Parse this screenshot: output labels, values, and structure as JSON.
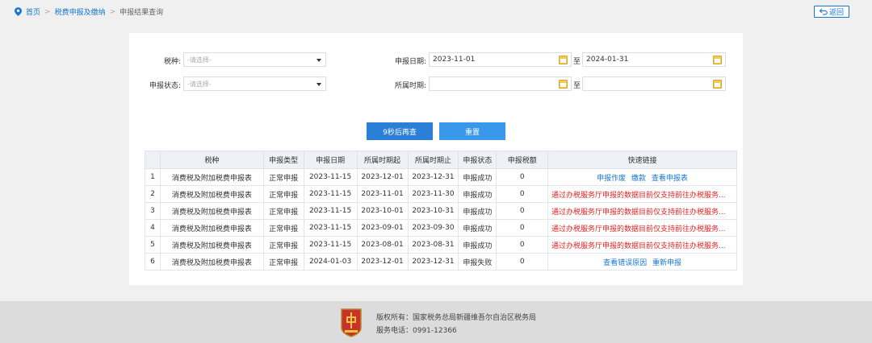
{
  "breadcrumb": {
    "home": "首页",
    "section": "税费申报及缴纳",
    "current": "申报结果查询",
    "sep": ">"
  },
  "back_label": "返回",
  "form": {
    "tax_type_label": "税种:",
    "tax_type_placeholder": "-请选择-",
    "status_label": "申报状态:",
    "status_placeholder": "-请选择-",
    "date_label": "申报日期:",
    "date_from": "2023-11-01",
    "date_to": "2024-01-31",
    "period_label": "所属时期:",
    "period_from": "",
    "period_to": "",
    "to": "至"
  },
  "buttons": {
    "query": "9秒后再查",
    "reset": "重置"
  },
  "table": {
    "headers": [
      "",
      "税种",
      "申报类型",
      "申报日期",
      "所属时期起",
      "所属时期止",
      "申报状态",
      "申报税额",
      "快速链接"
    ],
    "rows": [
      {
        "no": "1",
        "tax": "消费税及附加税费申报表",
        "type": "正常申报",
        "date": "2023-11-15",
        "from": "2023-12-01",
        "to": "2023-12-31",
        "status": "申报成功",
        "amount": "0",
        "links": [
          "申报作废",
          "缴款",
          "查看申报表"
        ],
        "msg": ""
      },
      {
        "no": "2",
        "tax": "消费税及附加税费申报表",
        "type": "正常申报",
        "date": "2023-11-15",
        "from": "2023-11-01",
        "to": "2023-11-30",
        "status": "申报成功",
        "amount": "0",
        "links": [],
        "msg": "通过办税服务厅申报的数据目前仅支持前往办税服务..."
      },
      {
        "no": "3",
        "tax": "消费税及附加税费申报表",
        "type": "正常申报",
        "date": "2023-11-15",
        "from": "2023-10-01",
        "to": "2023-10-31",
        "status": "申报成功",
        "amount": "0",
        "links": [],
        "msg": "通过办税服务厅申报的数据目前仅支持前往办税服务..."
      },
      {
        "no": "4",
        "tax": "消费税及附加税费申报表",
        "type": "正常申报",
        "date": "2023-11-15",
        "from": "2023-09-01",
        "to": "2023-09-30",
        "status": "申报成功",
        "amount": "0",
        "links": [],
        "msg": "通过办税服务厅申报的数据目前仅支持前往办税服务..."
      },
      {
        "no": "5",
        "tax": "消费税及附加税费申报表",
        "type": "正常申报",
        "date": "2023-11-15",
        "from": "2023-08-01",
        "to": "2023-08-31",
        "status": "申报成功",
        "amount": "0",
        "links": [],
        "msg": "通过办税服务厅申报的数据目前仅支持前往办税服务..."
      },
      {
        "no": "6",
        "tax": "消费税及附加税费申报表",
        "type": "正常申报",
        "date": "2024-01-03",
        "from": "2023-12-01",
        "to": "2023-12-31",
        "status": "申报失败",
        "amount": "0",
        "links": [
          "查看错误原因",
          "重新申报"
        ],
        "msg": ""
      }
    ]
  },
  "footer": {
    "copyright": "版权所有：国家税务总局新疆维吾尔自治区税务局",
    "phone": "服务电话：0991-12366"
  },
  "colors": {
    "accent": "#1677d2",
    "button": "#3a98ea",
    "error": "#e02424"
  }
}
